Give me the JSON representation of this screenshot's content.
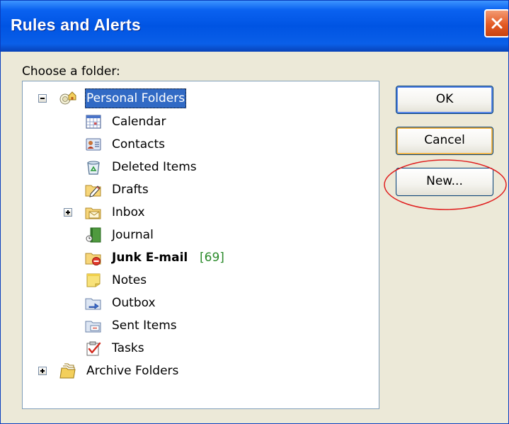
{
  "window": {
    "title": "Rules and Alerts"
  },
  "dialog": {
    "prompt": "Choose a folder:"
  },
  "tree": {
    "root": {
      "label": "Personal Folders",
      "icon": "personal-folders-icon",
      "expander": "minus"
    },
    "items": [
      {
        "label": "Calendar",
        "icon": "calendar-icon"
      },
      {
        "label": "Contacts",
        "icon": "contacts-icon"
      },
      {
        "label": "Deleted Items",
        "icon": "deleted-items-icon"
      },
      {
        "label": "Drafts",
        "icon": "drafts-icon"
      },
      {
        "label": "Inbox",
        "icon": "inbox-icon",
        "expander": "plus"
      },
      {
        "label": "Journal",
        "icon": "journal-icon"
      },
      {
        "label": "Junk E-mail",
        "icon": "junk-email-icon",
        "count": "[69]",
        "bold": true
      },
      {
        "label": "Notes",
        "icon": "notes-icon"
      },
      {
        "label": "Outbox",
        "icon": "outbox-icon"
      },
      {
        "label": "Sent Items",
        "icon": "sent-items-icon"
      },
      {
        "label": "Tasks",
        "icon": "tasks-icon"
      }
    ],
    "archive": {
      "label": "Archive Folders",
      "icon": "archive-folders-icon",
      "expander": "plus"
    }
  },
  "buttons": {
    "ok": "OK",
    "cancel": "Cancel",
    "new": "New..."
  },
  "colors": {
    "title_bar": "#0054e3",
    "selection": "#316ac5",
    "count_text": "#2a8a2a",
    "annotation_circle": "#e02020"
  }
}
